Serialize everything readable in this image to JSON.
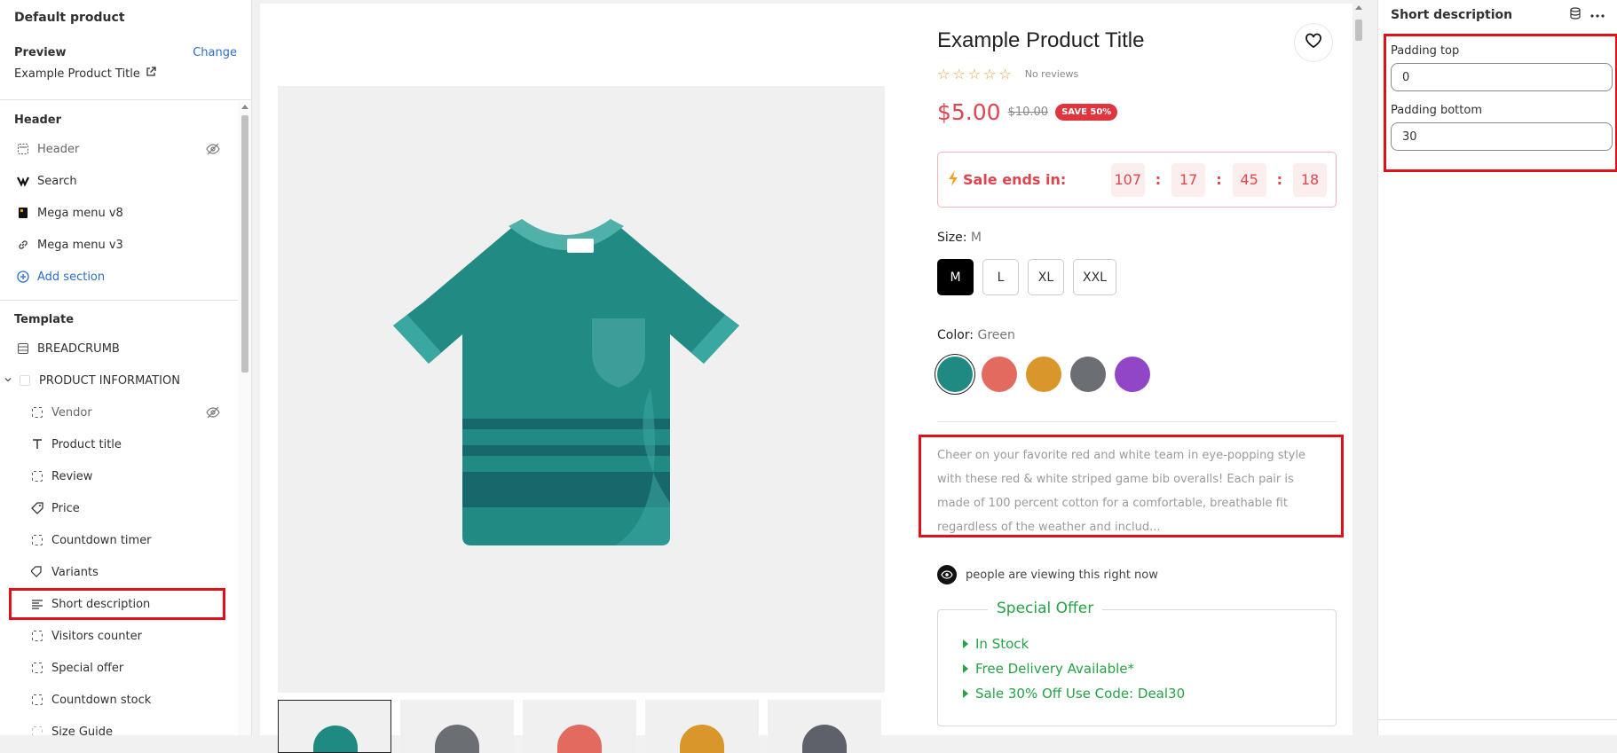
{
  "left_panel": {
    "title": "Default product",
    "preview_label": "Preview",
    "change_label": "Change",
    "preview_value": "Example Product Title",
    "header_group": "Header",
    "header_items": [
      {
        "label": "Header",
        "icon": "header-layout-icon",
        "hidden": true
      },
      {
        "label": "Search",
        "icon": "search-app-icon",
        "hidden": false
      },
      {
        "label": "Mega menu v8",
        "icon": "mega-menu-app-icon",
        "hidden": false
      },
      {
        "label": "Mega menu v3",
        "icon": "link-icon",
        "hidden": false
      }
    ],
    "add_section": "Add section",
    "template_group": "Template",
    "template_items": [
      {
        "label": "BREADCRUMB",
        "icon": "section-icon"
      },
      {
        "label": "PRODUCT INFORMATION",
        "icon": "section-icon"
      }
    ],
    "blocks": [
      {
        "label": "Vendor",
        "icon": "block-icon",
        "hidden": true
      },
      {
        "label": "Product title",
        "icon": "text-icon",
        "hidden": false
      },
      {
        "label": "Review",
        "icon": "block-icon",
        "hidden": false
      },
      {
        "label": "Price",
        "icon": "price-tag-icon",
        "hidden": false
      },
      {
        "label": "Countdown timer",
        "icon": "block-icon",
        "hidden": false
      },
      {
        "label": "Variants",
        "icon": "variants-icon",
        "hidden": false
      },
      {
        "label": "Short description",
        "icon": "align-left-icon",
        "hidden": false,
        "selected": true
      },
      {
        "label": "Visitors counter",
        "icon": "block-icon",
        "hidden": false
      },
      {
        "label": "Special offer",
        "icon": "block-icon",
        "hidden": false
      },
      {
        "label": "Countdown stock",
        "icon": "block-icon",
        "hidden": false
      },
      {
        "label": "Size Guide",
        "icon": "block-icon",
        "hidden": false
      }
    ]
  },
  "product": {
    "title": "Example Product Title",
    "rating_text": "No reviews",
    "rating": 0,
    "price": "$5.00",
    "compare_price": "$10.00",
    "save_badge": "SAVE 50%",
    "sale_label": "Sale ends in:",
    "countdown": [
      "107",
      "17",
      "45",
      "18"
    ],
    "countdown_sep": ":",
    "size_label": "Size:",
    "size_value": "M",
    "sizes": [
      "M",
      "L",
      "XL",
      "XXL"
    ],
    "color_label": "Color:",
    "color_value": "Green",
    "colors": [
      "#1f8a82",
      "#e26a5e",
      "#d9962b",
      "#6b6e72",
      "#9146c8"
    ],
    "description": "Cheer on your favorite red and white team in eye-popping style with these red & white striped game bib overalls! Each pair is made of 100 percent cotton for a comfortable, breathable fit regardless of the weather and includ...",
    "viewers_text": "people are viewing this right now",
    "offer_title": "Special Offer",
    "offer_lines": [
      "In Stock",
      "Free Delivery Available*",
      "Sale 30% Off Use Code: Deal30"
    ],
    "thumb_colors": [
      "#1f8a82",
      "#6b6e72",
      "#e26a5e",
      "#d9962b",
      "#5e6169"
    ]
  },
  "right_panel": {
    "title": "Short description",
    "padding_top_label": "Padding top",
    "padding_top_value": "0",
    "padding_bottom_label": "Padding bottom",
    "padding_bottom_value": "30"
  },
  "colors": {
    "accent": "#2c6ecb",
    "highlight": "#e0101a",
    "sale": "#e0454f",
    "offer": "#25a244"
  }
}
